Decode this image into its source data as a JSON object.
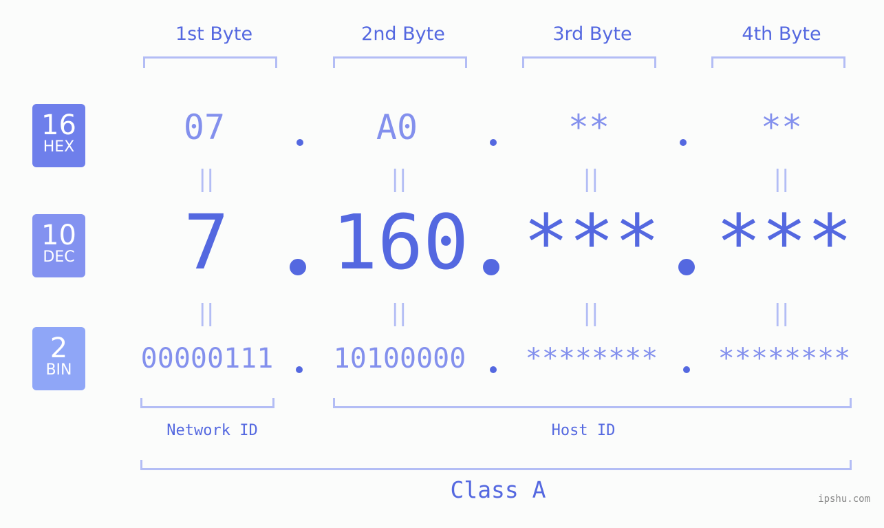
{
  "bytes": [
    {
      "header": "1st Byte",
      "hex": "07",
      "dec": "7",
      "bin": "00000111"
    },
    {
      "header": "2nd Byte",
      "hex": "A0",
      "dec": "160",
      "bin": "10100000"
    },
    {
      "header": "3rd Byte",
      "hex": "**",
      "dec": "***",
      "bin": "********"
    },
    {
      "header": "4th Byte",
      "hex": "**",
      "dec": "***",
      "bin": "********"
    }
  ],
  "badges": {
    "hex": {
      "num": "16",
      "label": "HEX",
      "color": "#6e7feb"
    },
    "dec": {
      "num": "10",
      "label": "DEC",
      "color": "#8392f0"
    },
    "bin": {
      "num": "2",
      "label": "BIN",
      "color": "#8fa6f7"
    }
  },
  "equals": "||",
  "network_id": "Network ID",
  "host_id": "Host ID",
  "class_label": "Class A",
  "watermark": "ipshu.com"
}
